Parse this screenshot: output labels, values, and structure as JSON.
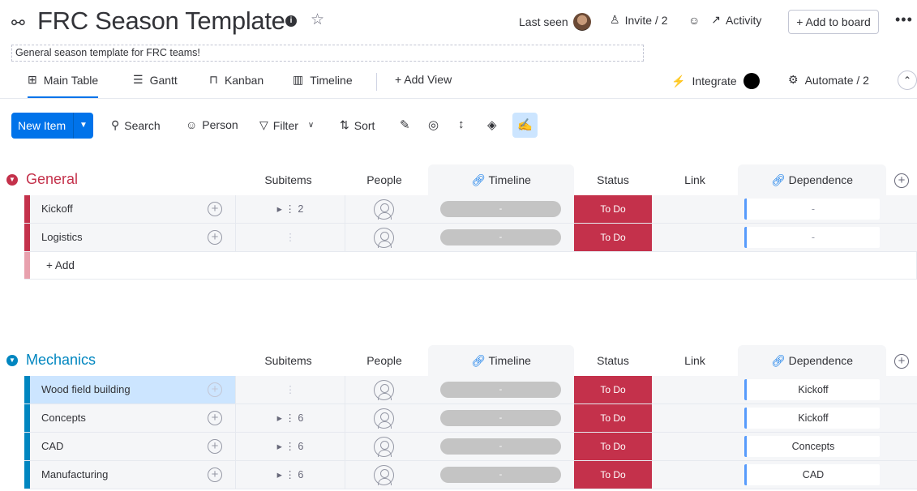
{
  "board": {
    "title": "FRC Season Template",
    "description": "General season template for FRC teams!",
    "last_seen": "Last seen",
    "invite": "Invite / 2",
    "activity": "Activity",
    "add_to_board": "+ Add to board",
    "more": "•••"
  },
  "views": {
    "main_table": "Main Table",
    "gantt": "Gantt",
    "kanban": "Kanban",
    "timeline": "Timeline",
    "add_view": "+ Add View",
    "integrate": "Integrate",
    "automate": "Automate / 2"
  },
  "toolbar": {
    "new_item": "New Item",
    "search": "Search",
    "person": "Person",
    "filter": "Filter",
    "sort": "Sort"
  },
  "columns": {
    "subitems": "Subitems",
    "people": "People",
    "timeline": "Timeline",
    "status": "Status",
    "link": "Link",
    "dependence": "Dependence"
  },
  "groups": [
    {
      "name": "General",
      "color": "#c4314b",
      "add_label": "+ Add",
      "rows": [
        {
          "name": "Kickoff",
          "subitems": "2",
          "timeline": "-",
          "status": "To Do",
          "dependence": "-"
        },
        {
          "name": "Logistics",
          "subitems": "",
          "timeline": "-",
          "status": "To Do",
          "dependence": "-"
        }
      ]
    },
    {
      "name": "Mechanics",
      "color": "#0086c0",
      "rows": [
        {
          "name": "Wood field building",
          "subitems": "",
          "timeline": "-",
          "status": "To Do",
          "dependence": "Kickoff"
        },
        {
          "name": "Concepts",
          "subitems": "6",
          "timeline": "-",
          "status": "To Do",
          "dependence": "Kickoff"
        },
        {
          "name": "CAD",
          "subitems": "6",
          "timeline": "-",
          "status": "To Do",
          "dependence": "Concepts"
        },
        {
          "name": "Manufacturing",
          "subitems": "6",
          "timeline": "-",
          "status": "To Do",
          "dependence": "CAD"
        }
      ]
    }
  ]
}
